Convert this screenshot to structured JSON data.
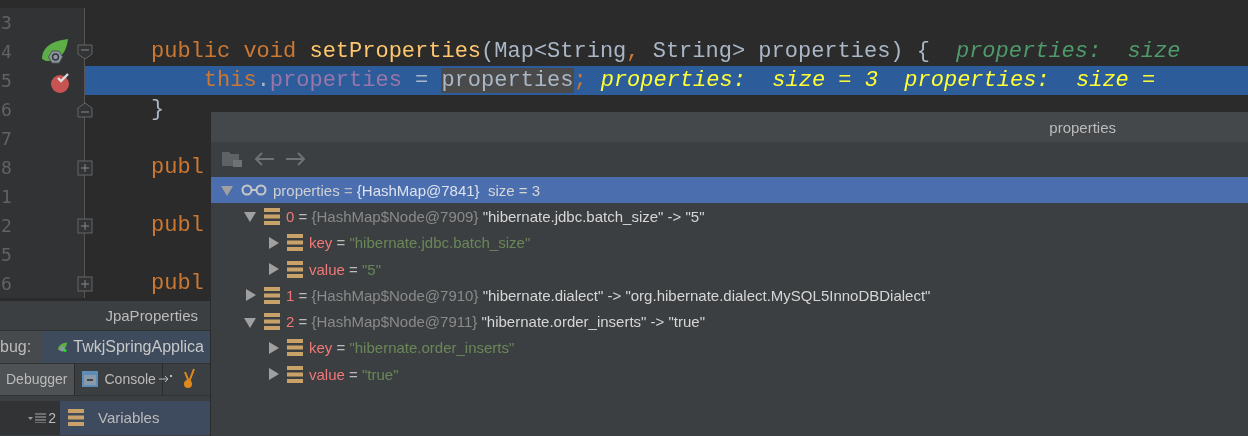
{
  "editor": {
    "lines": [
      {
        "number": "3"
      },
      {
        "number": "4",
        "gutter": {
          "kind": "spring"
        },
        "fold": {
          "kind": "start"
        },
        "current": false,
        "tokens": [
          {
            "kind": "keyword",
            "text": "public void "
          },
          {
            "kind": "method",
            "text": "setProperties"
          },
          {
            "kind": "plain",
            "text": "(Map<String"
          },
          {
            "kind": "keyword",
            "text": ","
          },
          {
            "kind": "plain",
            "text": " String> properties) {"
          }
        ],
        "hint": "properties:  size"
      },
      {
        "number": "5",
        "gutter": {
          "kind": "breakpoint"
        },
        "current": true,
        "tokens": [
          {
            "kind": "keyword",
            "text": "    this"
          },
          {
            "kind": "plain",
            "text": "."
          },
          {
            "kind": "field",
            "text": "properties"
          },
          {
            "kind": "plain",
            "text": " = "
          },
          {
            "kind": "usage",
            "text": "properties"
          },
          {
            "kind": "keyword",
            "text": ";"
          }
        ],
        "hint": "properties:  size = 3  properties:  size ="
      },
      {
        "number": "6",
        "fold": {
          "kind": "end"
        },
        "current": false,
        "tokens": [
          {
            "kind": "plain",
            "text": "}"
          }
        ]
      },
      {
        "number": "7"
      },
      {
        "number": "8",
        "fold": {
          "kind": "collapsed"
        },
        "current": false,
        "tokens": [
          {
            "kind": "keyword",
            "text": "publ"
          }
        ]
      },
      {
        "number": "1"
      },
      {
        "number": "2",
        "fold": {
          "kind": "collapsed"
        },
        "current": false,
        "tokens": [
          {
            "kind": "keyword",
            "text": "publ"
          }
        ]
      },
      {
        "number": "5"
      },
      {
        "number": "6",
        "fold": {
          "kind": "collapsed"
        },
        "current": false,
        "tokens": [
          {
            "kind": "keyword",
            "text": "publ"
          }
        ]
      }
    ]
  },
  "debug_panel": {
    "title": "JpaProperties",
    "label": "bug:",
    "config_tab": "TwkjSpringApplica",
    "tabs": [
      {
        "label": "Debugger",
        "selected": true
      },
      {
        "label": "Console",
        "selected": false
      }
    ],
    "frames_count": "2",
    "variables_header": "Variables"
  },
  "popup": {
    "title": "properties",
    "tree": [
      {
        "kind": "watch",
        "expanded": true,
        "selected": true,
        "parts": [
          {
            "kind": "root",
            "text": "properties"
          },
          {
            "kind": "op",
            "text": "="
          },
          {
            "kind": "type",
            "text": "{HashMap@7841}"
          },
          {
            "kind": "value",
            "text": " size = 3"
          }
        ],
        "children": [
          {
            "kind": "field",
            "expanded": true,
            "selected": false,
            "parts": [
              {
                "kind": "name",
                "text": "0"
              },
              {
                "kind": "op",
                "text": "="
              },
              {
                "kind": "type",
                "text": "{HashMap$Node@7909}"
              },
              {
                "kind": "value",
                "text": "\"hibernate.jdbc.batch_size\" -> \"5\""
              }
            ],
            "children": [
              {
                "kind": "field",
                "expanded": false,
                "selected": false,
                "parts": [
                  {
                    "kind": "name",
                    "text": "key"
                  },
                  {
                    "kind": "op",
                    "text": "="
                  },
                  {
                    "kind": "string",
                    "text": "\"hibernate.jdbc.batch_size\""
                  }
                ]
              },
              {
                "kind": "field",
                "expanded": false,
                "selected": false,
                "parts": [
                  {
                    "kind": "name",
                    "text": "value"
                  },
                  {
                    "kind": "op",
                    "text": "="
                  },
                  {
                    "kind": "string",
                    "text": "\"5\""
                  }
                ]
              }
            ]
          },
          {
            "kind": "field",
            "expanded": false,
            "selected": false,
            "parts": [
              {
                "kind": "name",
                "text": "1"
              },
              {
                "kind": "op",
                "text": "="
              },
              {
                "kind": "type",
                "text": "{HashMap$Node@7910}"
              },
              {
                "kind": "value",
                "text": "\"hibernate.dialect\" -> \"org.hibernate.dialect.MySQL5InnoDBDialect\""
              }
            ]
          },
          {
            "kind": "field",
            "expanded": true,
            "selected": false,
            "parts": [
              {
                "kind": "name",
                "text": "2"
              },
              {
                "kind": "op",
                "text": "="
              },
              {
                "kind": "type",
                "text": "{HashMap$Node@7911}"
              },
              {
                "kind": "value",
                "text": "\"hibernate.order_inserts\" -> \"true\""
              }
            ],
            "children": [
              {
                "kind": "field",
                "expanded": false,
                "selected": false,
                "parts": [
                  {
                    "kind": "name",
                    "text": "key"
                  },
                  {
                    "kind": "op",
                    "text": "="
                  },
                  {
                    "kind": "string",
                    "text": "\"hibernate.order_inserts\""
                  }
                ]
              },
              {
                "kind": "field",
                "expanded": false,
                "selected": false,
                "parts": [
                  {
                    "kind": "name",
                    "text": "value"
                  },
                  {
                    "kind": "op",
                    "text": "="
                  },
                  {
                    "kind": "string",
                    "text": "\"true\""
                  }
                ]
              }
            ]
          }
        ]
      }
    ]
  }
}
